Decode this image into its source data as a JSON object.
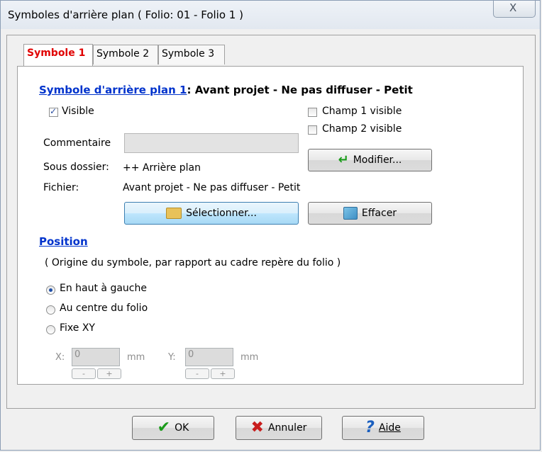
{
  "window": {
    "title": "Symboles d'arrière plan ( Folio: 01 - Folio 1 )",
    "close_glyph": "X"
  },
  "tabs": [
    {
      "label": "Symbole 1",
      "active": true
    },
    {
      "label": "Symbole 2",
      "active": false
    },
    {
      "label": "Symbole 3",
      "active": false
    }
  ],
  "symbol": {
    "heading_link": "Symbole d'arrière plan 1",
    "heading_rest": ": Avant projet - Ne pas diffuser - Petit",
    "visible_label": "Visible",
    "visible_checked": true,
    "champ1_label": "Champ 1 visible",
    "champ1_checked": false,
    "champ2_label": "Champ 2 visible",
    "champ2_checked": false,
    "commentaire_label": "Commentaire",
    "commentaire_value": "",
    "modifier_label": "Modifier...",
    "sous_dossier_label": "Sous dossier:",
    "sous_dossier_value": "++ Arrière plan",
    "fichier_label": "Fichier:",
    "fichier_value": "Avant projet - Ne pas diffuser - Petit",
    "selectionner_label": "Sélectionner...",
    "effacer_label": "Effacer"
  },
  "position": {
    "heading": "Position",
    "description": "( Origine du symbole, par rapport au cadre repère du folio )",
    "options": [
      {
        "label": "En haut à gauche",
        "selected": true
      },
      {
        "label": "Au centre du folio",
        "selected": false
      },
      {
        "label": "Fixe XY",
        "selected": false
      }
    ],
    "x_label": "X:",
    "x_value": "0",
    "y_label": "Y:",
    "y_value": "0",
    "unit": "mm",
    "minus": "-",
    "plus": "+"
  },
  "footer": {
    "ok_label": "OK",
    "annuler_label": "Annuler",
    "aide_label": "Aide"
  },
  "colors": {
    "active_tab": "#e00000",
    "link": "#0033cc",
    "focus_button": "#a7d9f5"
  }
}
